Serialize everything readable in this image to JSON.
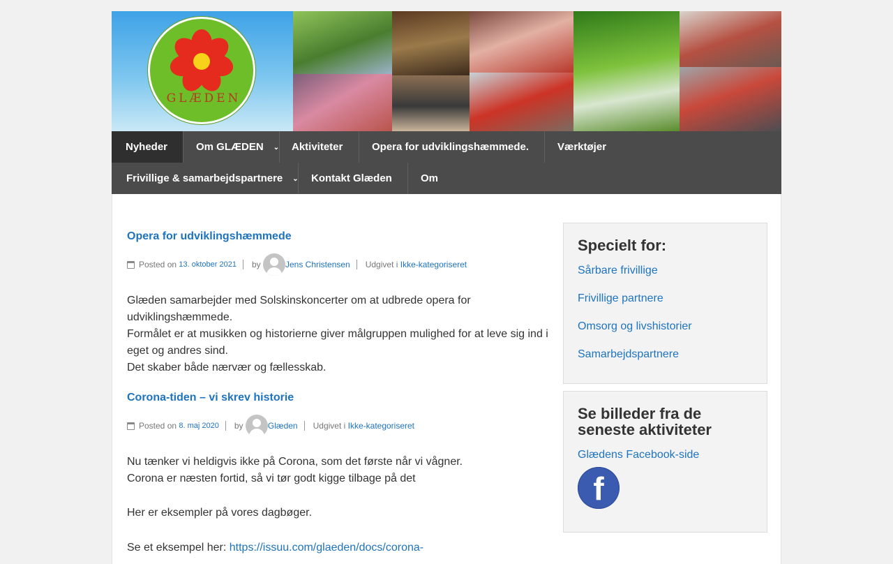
{
  "logo": {
    "text": "GLÆDEN"
  },
  "nav": {
    "items": [
      {
        "label": "Nyheder"
      },
      {
        "label": "Om GLÆDEN"
      },
      {
        "label": "Aktiviteter"
      },
      {
        "label": "Opera for udviklingshæmmede."
      },
      {
        "label": "Værktøjer"
      },
      {
        "label": "Frivillige & samarbejdspartnere"
      },
      {
        "label": "Kontakt Glæden"
      },
      {
        "label": "Om"
      }
    ]
  },
  "posts": [
    {
      "title": "Opera for udviklingshæmmede",
      "posted_on": "Posted on",
      "date": "13. oktober 2021",
      "by": "by",
      "author": "Jens Christensen",
      "category_label": "Udgivet i",
      "category": "Ikke-kategoriseret",
      "lines": [
        "Glæden samarbejder med Solskinskoncerter om at udbrede opera for udviklingshæmmede.",
        "Formålet er at musikken og historierne giver målgruppen mulighed for at leve sig ind i eget og andres sind.",
        "Det skaber både nærvær og fællesskab."
      ]
    },
    {
      "title": "Corona-tiden – vi skrev historie",
      "posted_on": "Posted on",
      "date": "8. maj 2020",
      "by": "by",
      "author": "Glæden",
      "category_label": "Udgivet i",
      "category": "Ikke-kategoriseret",
      "lines": [
        "Nu tænker vi heldigvis ikke på Corona, som det første når vi vågner.",
        "Corona er næsten fortid, så vi tør godt kigge tilbage på det",
        "Her er eksempler på vores dagbøger.",
        "Se et eksempel her: "
      ],
      "link": "https://issuu.com/glaeden/docs/corona-"
    }
  ],
  "sidebar": {
    "widget1": {
      "title": "Specielt for:",
      "links": [
        "Sårbare frivillige",
        "Frivillige partnere",
        "Omsorg og livshistorier",
        "Samarbejdspartnere"
      ]
    },
    "widget2": {
      "title": "Se billeder fra de seneste aktiviteter",
      "link": "Glædens Facebook-side",
      "icon_glyph": "f"
    }
  },
  "colors": {
    "link": "#1e73be",
    "nav_bg": "#4b4b4b",
    "nav_active": "#2f2f2f"
  }
}
